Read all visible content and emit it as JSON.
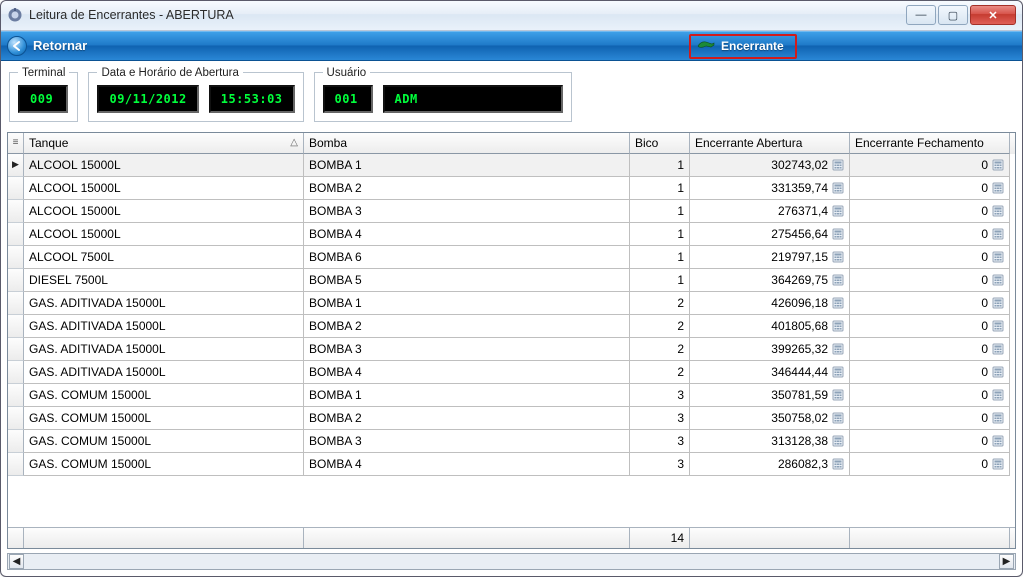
{
  "window": {
    "title": "Leitura de Encerrantes - ABERTURA"
  },
  "toolbar": {
    "retornar": "Retornar",
    "encerrante": "Encerrante"
  },
  "groups": {
    "terminal": {
      "legend": "Terminal",
      "value": "009"
    },
    "abertura": {
      "legend": "Data e Horário de Abertura",
      "date": "09/11/2012",
      "time": "15:53:03"
    },
    "usuario": {
      "legend": "Usuário",
      "code": "001",
      "name": "ADM"
    }
  },
  "grid": {
    "columns": {
      "tanque": "Tanque",
      "bomba": "Bomba",
      "bico": "Bico",
      "abertura": "Encerrante Abertura",
      "fechamento": "Encerrante Fechamento"
    },
    "rows": [
      {
        "tanque": "ALCOOL 15000L",
        "bomba": "BOMBA 1",
        "bico": "1",
        "abertura": "302743,02",
        "fechamento": "0"
      },
      {
        "tanque": "ALCOOL 15000L",
        "bomba": "BOMBA 2",
        "bico": "1",
        "abertura": "331359,74",
        "fechamento": "0"
      },
      {
        "tanque": "ALCOOL 15000L",
        "bomba": "BOMBA 3",
        "bico": "1",
        "abertura": "276371,4",
        "fechamento": "0"
      },
      {
        "tanque": "ALCOOL 15000L",
        "bomba": "BOMBA 4",
        "bico": "1",
        "abertura": "275456,64",
        "fechamento": "0"
      },
      {
        "tanque": "ALCOOL 7500L",
        "bomba": "BOMBA 6",
        "bico": "1",
        "abertura": "219797,15",
        "fechamento": "0"
      },
      {
        "tanque": "DIESEL 7500L",
        "bomba": "BOMBA 5",
        "bico": "1",
        "abertura": "364269,75",
        "fechamento": "0"
      },
      {
        "tanque": "GAS. ADITIVADA 15000L",
        "bomba": "BOMBA 1",
        "bico": "2",
        "abertura": "426096,18",
        "fechamento": "0"
      },
      {
        "tanque": "GAS. ADITIVADA 15000L",
        "bomba": "BOMBA 2",
        "bico": "2",
        "abertura": "401805,68",
        "fechamento": "0"
      },
      {
        "tanque": "GAS. ADITIVADA 15000L",
        "bomba": "BOMBA 3",
        "bico": "2",
        "abertura": "399265,32",
        "fechamento": "0"
      },
      {
        "tanque": "GAS. ADITIVADA 15000L",
        "bomba": "BOMBA 4",
        "bico": "2",
        "abertura": "346444,44",
        "fechamento": "0"
      },
      {
        "tanque": "GAS. COMUM 15000L",
        "bomba": "BOMBA 1",
        "bico": "3",
        "abertura": "350781,59",
        "fechamento": "0"
      },
      {
        "tanque": "GAS. COMUM 15000L",
        "bomba": "BOMBA 2",
        "bico": "3",
        "abertura": "350758,02",
        "fechamento": "0"
      },
      {
        "tanque": "GAS. COMUM 15000L",
        "bomba": "BOMBA 3",
        "bico": "3",
        "abertura": "313128,38",
        "fechamento": "0"
      },
      {
        "tanque": "GAS. COMUM 15000L",
        "bomba": "BOMBA 4",
        "bico": "3",
        "abertura": "286082,3",
        "fechamento": "0"
      }
    ],
    "footer_count": "14"
  }
}
